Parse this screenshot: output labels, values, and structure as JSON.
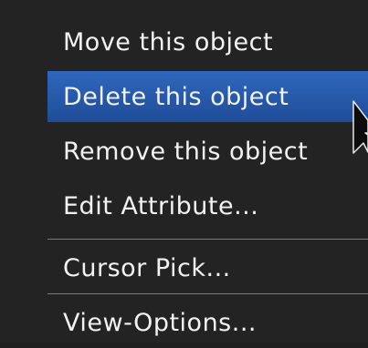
{
  "menu": {
    "items": [
      {
        "label": "Move this object",
        "highlighted": false
      },
      {
        "label": "Delete this object",
        "highlighted": true
      },
      {
        "label": "Remove this object",
        "highlighted": false
      },
      {
        "label": "Edit Attribute...",
        "highlighted": false
      },
      {
        "label": "Cursor Pick...",
        "highlighted": false
      },
      {
        "label": "View-Options...",
        "highlighted": false
      }
    ]
  },
  "colors": {
    "background": "#232323",
    "text": "#f2f2f2",
    "highlight": "#2b61b4",
    "separator": "#7a7a7a"
  },
  "icons": {
    "cursor": "mouse-pointer-icon"
  }
}
